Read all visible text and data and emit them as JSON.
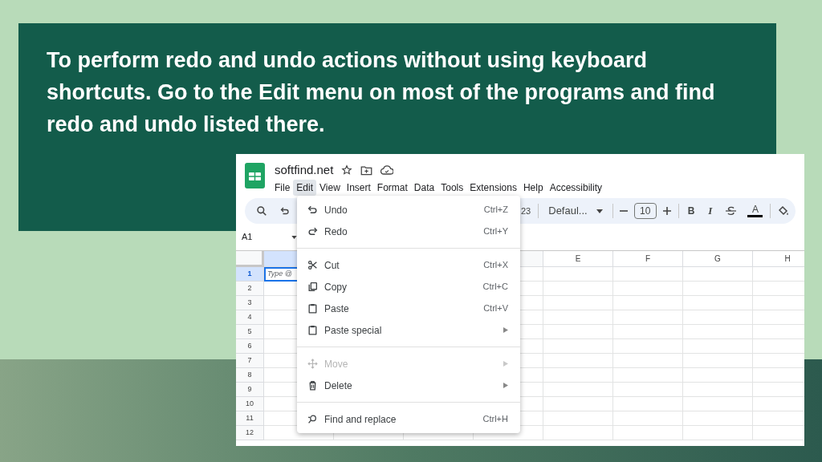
{
  "slide": {
    "caption": "To perform redo and undo actions without using keyboard shortcuts. Go to the Edit menu on most of the programs and find redo and undo listed there."
  },
  "app": {
    "title": "softfind.net",
    "menus": [
      {
        "label": "File",
        "selected": false
      },
      {
        "label": "Edit",
        "selected": true
      },
      {
        "label": "View",
        "selected": false
      },
      {
        "label": "Insert",
        "selected": false
      },
      {
        "label": "Format",
        "selected": false
      },
      {
        "label": "Data",
        "selected": false
      },
      {
        "label": "Tools",
        "selected": false
      },
      {
        "label": "Extensions",
        "selected": false
      },
      {
        "label": "Help",
        "selected": false
      },
      {
        "label": "Accessibility",
        "selected": false
      }
    ],
    "toolbar": {
      "number_format": "23",
      "font": "Defaul...",
      "font_size": "10",
      "bold": "B",
      "italic": "I",
      "text_color": "A"
    },
    "name_box": "A1",
    "sheet": {
      "columns": [
        "E",
        "F",
        "G",
        "H"
      ],
      "rows": [
        {
          "label": "1",
          "selected": true
        },
        {
          "label": "2",
          "selected": false
        },
        {
          "label": "3",
          "selected": false
        },
        {
          "label": "4",
          "selected": false
        },
        {
          "label": "5",
          "selected": false
        },
        {
          "label": "6",
          "selected": false
        },
        {
          "label": "7",
          "selected": false
        },
        {
          "label": "8",
          "selected": false
        },
        {
          "label": "9",
          "selected": false
        },
        {
          "label": "10",
          "selected": false
        },
        {
          "label": "11",
          "selected": false
        },
        {
          "label": "12",
          "selected": false
        }
      ],
      "active_cell": {
        "placeholder": "Type @"
      }
    },
    "edit_menu": [
      {
        "kind": "item",
        "label": "Undo",
        "shortcut": "Ctrl+Z",
        "disabled": false,
        "submenu": false
      },
      {
        "kind": "item",
        "label": "Redo",
        "shortcut": "Ctrl+Y",
        "disabled": false,
        "submenu": false
      },
      {
        "kind": "divider"
      },
      {
        "kind": "item",
        "label": "Cut",
        "shortcut": "Ctrl+X",
        "disabled": false,
        "submenu": false
      },
      {
        "kind": "item",
        "label": "Copy",
        "shortcut": "Ctrl+C",
        "disabled": false,
        "submenu": false
      },
      {
        "kind": "item",
        "label": "Paste",
        "shortcut": "Ctrl+V",
        "disabled": false,
        "submenu": false
      },
      {
        "kind": "item",
        "label": "Paste special",
        "disabled": false,
        "submenu": true
      },
      {
        "kind": "divider"
      },
      {
        "kind": "item",
        "label": "Move",
        "disabled": true,
        "submenu": true
      },
      {
        "kind": "item",
        "label": "Delete",
        "disabled": false,
        "submenu": true
      },
      {
        "kind": "divider"
      },
      {
        "kind": "item",
        "label": "Find and replace",
        "shortcut": "Ctrl+H",
        "disabled": false,
        "submenu": false
      }
    ]
  }
}
